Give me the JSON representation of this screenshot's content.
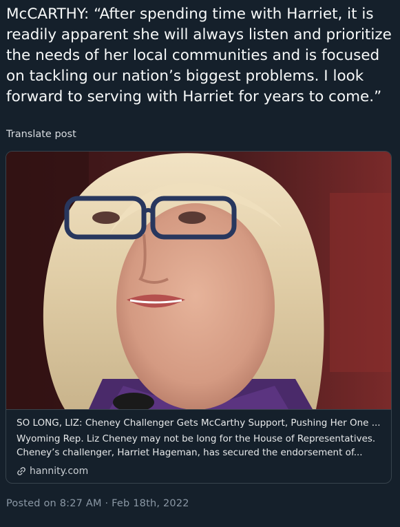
{
  "post": {
    "text": "McCARTHY: “After spending time with Harriet, it is\nreadily apparent she will always listen and prioritize\nthe needs of her local communities and is focused\non tackling our nation’s biggest problems. I look\nforward to serving with Harriet for years to come.”",
    "translate_label": "Translate post"
  },
  "link_card": {
    "title": "SO LONG, LIZ: Cheney Challenger Gets McCarthy Support, Pushing Her One ...",
    "description": "Wyoming Rep. Liz Cheney may not be long for the House of Representatives.\nCheney’s challenger, Harriet Hageman, has secured the endorsement of...",
    "domain": "hannity.com",
    "domain_icon": "link-icon"
  },
  "footer": {
    "posted_text": "Posted on 8:27 AM · Feb 18th, 2022"
  },
  "colors": {
    "background": "#15202b",
    "text": "#f7f9f9",
    "muted": "#8b98a5",
    "border": "#38444d"
  }
}
